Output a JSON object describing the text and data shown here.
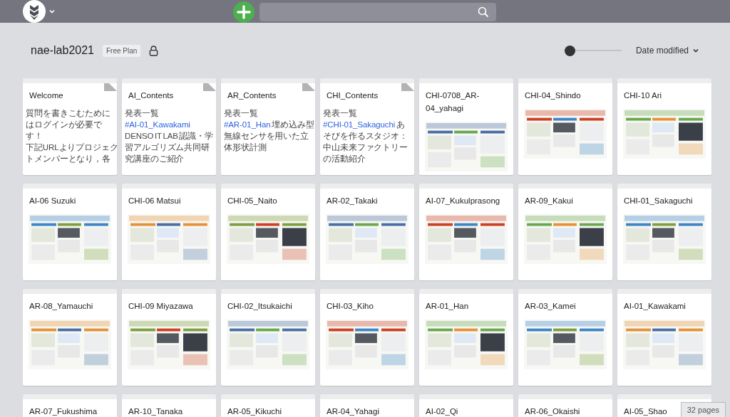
{
  "project": {
    "name": "nae-lab2021",
    "plan": "Free Plan"
  },
  "zoom_slider": {
    "level": 0
  },
  "sort": {
    "label": "Date modified"
  },
  "pages": [
    {
      "title": "Welcome",
      "kind": "text",
      "lines": [
        [
          {
            "text": "質問を書きこむために",
            "link": false
          }
        ],
        [
          {
            "text": "はログインが必要で",
            "link": false
          }
        ],
        [
          {
            "text": "す！",
            "link": false
          }
        ],
        [
          {
            "text": "下記URLよりプロジェク",
            "link": false
          }
        ],
        [
          {
            "text": "トメンバーとなり，各",
            "link": false
          }
        ]
      ]
    },
    {
      "title": "AI_Contents",
      "kind": "text",
      "lines": [
        [
          {
            "text": "発表一覧",
            "link": false
          }
        ],
        [
          {
            "text": "#AI-01_Kawakami",
            "link": true
          }
        ],
        [
          {
            "text": "DENSO IT LAB 認識・学",
            "link": false
          }
        ],
        [
          {
            "text": "習アルゴリズム共同研",
            "link": false
          }
        ],
        [
          {
            "text": "究講座のご紹介",
            "link": false
          }
        ]
      ]
    },
    {
      "title": "AR_Contents",
      "kind": "text",
      "lines": [
        [
          {
            "text": "発表一覧",
            "link": false
          }
        ],
        [
          {
            "text": "#AR-01_Han",
            "link": true
          },
          {
            "text": " 埋め込み型",
            "link": false
          }
        ],
        [
          {
            "text": "無線センサを用いた立",
            "link": false
          }
        ],
        [
          {
            "text": "体形状計測",
            "link": false
          }
        ]
      ]
    },
    {
      "title": "CHI_Contents",
      "kind": "text",
      "lines": [
        [
          {
            "text": "発表一覧",
            "link": false
          }
        ],
        [
          {
            "text": "#CHI-01_Sakaguchi",
            "link": true
          },
          {
            "text": " あ",
            "link": false
          }
        ],
        [
          {
            "text": "そびを作るスタジオ：",
            "link": false
          }
        ],
        [
          {
            "text": "中山未来ファクトリー",
            "link": false
          }
        ],
        [
          {
            "text": "の活動紹介",
            "link": false
          }
        ]
      ]
    },
    {
      "title": "CHI-0708_AR-04_yahagi",
      "kind": "picture"
    },
    {
      "title": "CHI-04_Shindo",
      "kind": "picture"
    },
    {
      "title": "CHI-10 Ari",
      "kind": "picture"
    },
    {
      "title": "AI-06 Suzuki",
      "kind": "picture"
    },
    {
      "title": "CHI-06 Matsui",
      "kind": "picture"
    },
    {
      "title": "CHI-05_Naito",
      "kind": "picture"
    },
    {
      "title": "AR-02_Takaki",
      "kind": "picture"
    },
    {
      "title": "AI-07_Kukulprasong",
      "kind": "picture"
    },
    {
      "title": "AR-09_Kakui",
      "kind": "picture"
    },
    {
      "title": "CHI-01_Sakaguchi",
      "kind": "picture"
    },
    {
      "title": "AR-08_Yamauchi",
      "kind": "picture"
    },
    {
      "title": "CHI-09 Miyazawa",
      "kind": "picture"
    },
    {
      "title": "CHI-02_Itsukaichi",
      "kind": "picture"
    },
    {
      "title": "CHI-03_Kiho",
      "kind": "picture"
    },
    {
      "title": "AR-01_Han",
      "kind": "picture"
    },
    {
      "title": "AR-03_Kamei",
      "kind": "picture"
    },
    {
      "title": "AI-01_Kawakami",
      "kind": "picture"
    },
    {
      "title": "AR-07_Fukushima",
      "kind": "title"
    },
    {
      "title": "AR-10_Tanaka",
      "kind": "title"
    },
    {
      "title": "AR-05_Kikuchi",
      "kind": "title"
    },
    {
      "title": "AR-04_Yahagi",
      "kind": "title"
    },
    {
      "title": "AI-02_Qi",
      "kind": "title"
    },
    {
      "title": "AR-06_Okaishi",
      "kind": "title"
    },
    {
      "title": "AI-05_Shao",
      "kind": "title"
    }
  ],
  "page_count": "32 pages"
}
